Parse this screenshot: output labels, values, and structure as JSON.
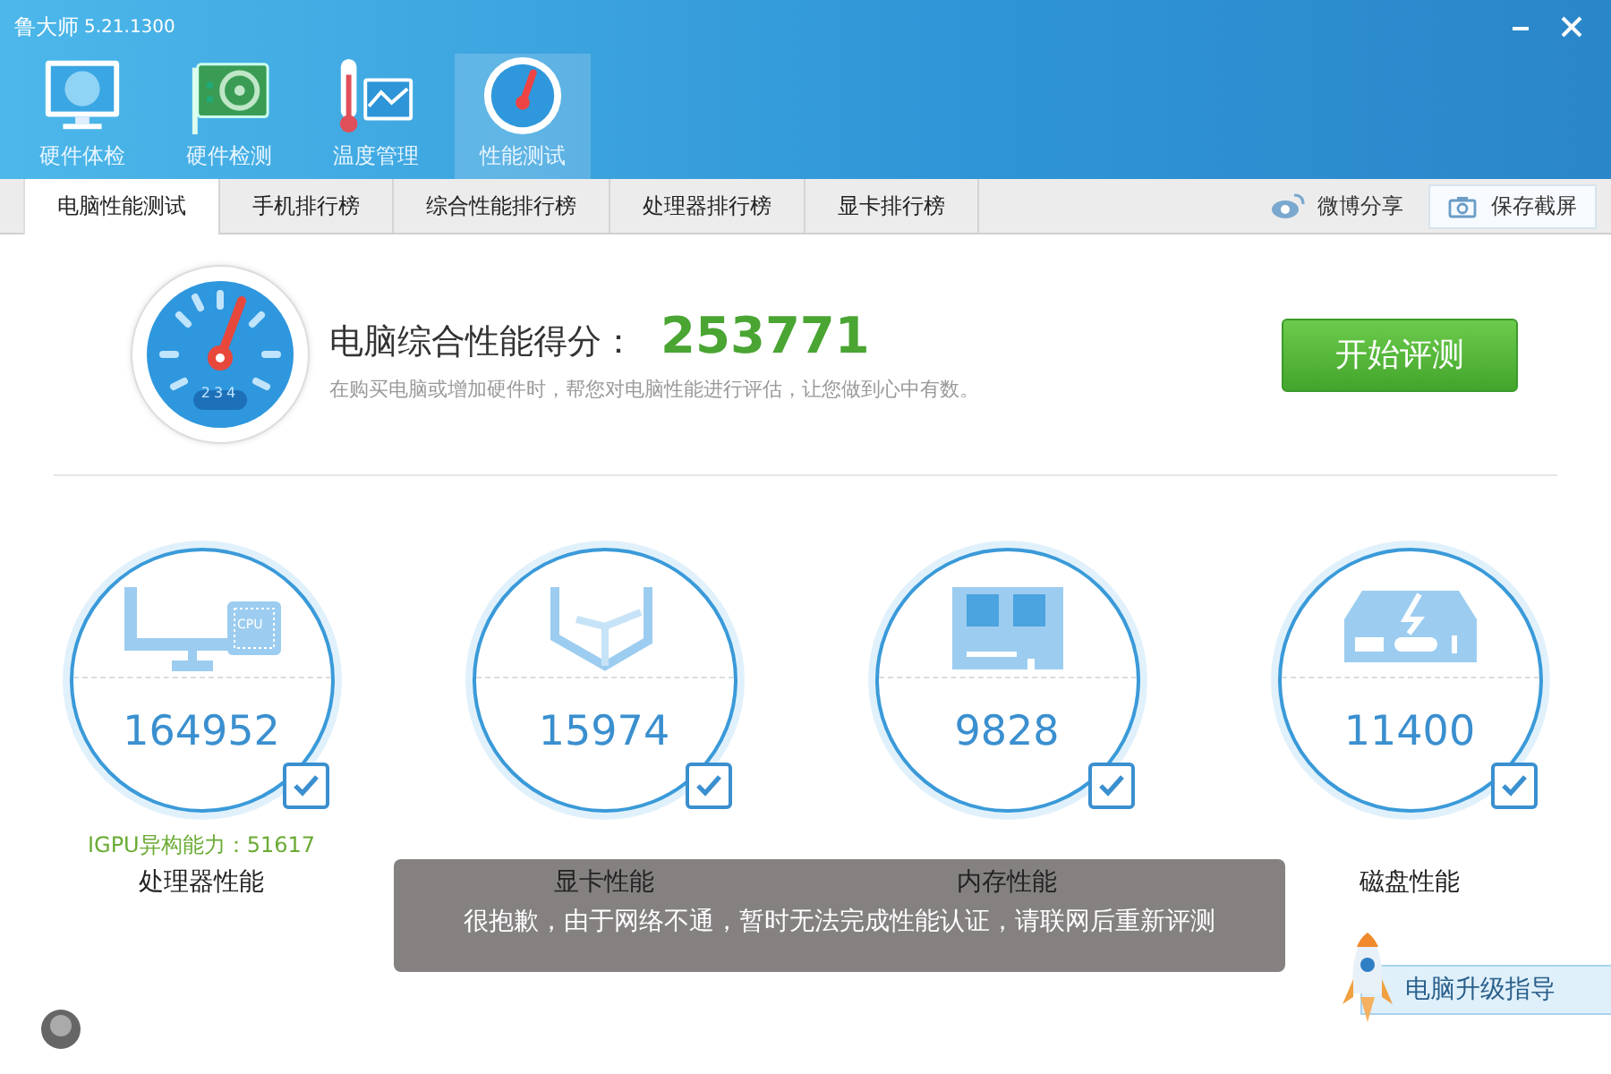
{
  "window": {
    "title": "鲁大师",
    "version": "5.21.1300"
  },
  "nav": [
    {
      "label": "硬件体检",
      "kind": "monitor",
      "selected": false
    },
    {
      "label": "硬件检测",
      "kind": "card",
      "selected": false
    },
    {
      "label": "温度管理",
      "kind": "thermo",
      "selected": false
    },
    {
      "label": "性能测试",
      "kind": "gauge",
      "selected": true
    }
  ],
  "tabs": [
    {
      "label": "电脑性能测试",
      "selected": true
    },
    {
      "label": "手机排行榜",
      "selected": false
    },
    {
      "label": "综合性能排行榜",
      "selected": false
    },
    {
      "label": "处理器排行榜",
      "selected": false
    },
    {
      "label": "显卡排行榜",
      "selected": false
    }
  ],
  "share": {
    "label": "微博分享"
  },
  "screenshot_button": {
    "label": "保存截屏"
  },
  "summary": {
    "gauge_digits": "234",
    "title": "电脑综合性能得分：",
    "score": "253771",
    "description": "在购买电脑或增加硬件时，帮您对电脑性能进行评估，让您做到心中有数。",
    "button": "开始评测"
  },
  "cards": [
    {
      "kind": "cpu",
      "chip_label": "CPU",
      "score": "164952",
      "checked": true,
      "extra": "IGPU异构能力：51617",
      "label": "处理器性能"
    },
    {
      "kind": "gpu",
      "score": "15974",
      "checked": true,
      "label": "显卡性能"
    },
    {
      "kind": "ram",
      "score": "9828",
      "checked": true,
      "label": "内存性能"
    },
    {
      "kind": "disk",
      "score": "11400",
      "checked": true,
      "label": "磁盘性能"
    }
  ],
  "toast": {
    "message": "很抱歉，由于网络不通，暂时无法完成性能认证，请联网后重新评测"
  },
  "upgrade_banner": {
    "label": "电脑升级指导"
  }
}
